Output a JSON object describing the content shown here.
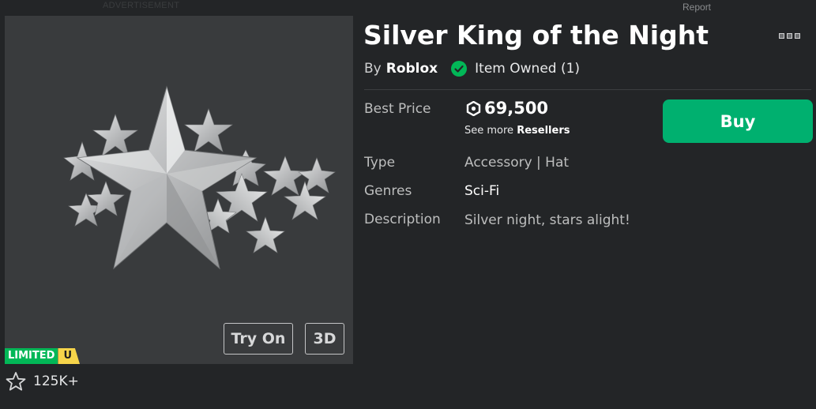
{
  "top_banner": {
    "advertisement_label": "ADVERTISEMENT",
    "report_label": "Report"
  },
  "thumbnail": {
    "try_on_label": "Try On",
    "view_3d_label": "3D",
    "limited_label": "LIMITED",
    "limited_u_label": "U",
    "favorite_count": "125K+"
  },
  "item": {
    "title": "Silver King of the Night",
    "by_label": "By",
    "creator": "Roblox",
    "owned_text": "Item Owned (1)"
  },
  "details": {
    "best_price_label": "Best Price",
    "price": "69,500",
    "see_more_prefix": "See more",
    "see_more_link": "Resellers",
    "buy_label": "Buy",
    "type_label": "Type",
    "type_value": "Accessory | Hat",
    "genres_label": "Genres",
    "genres_value": "Sci-Fi",
    "description_label": "Description",
    "description_value": "Silver night, stars alight!"
  },
  "colors": {
    "background": "#232527",
    "thumbnail_bg": "#393b3d",
    "buy_green": "#00b06f",
    "limited_green": "#02b757",
    "limited_yellow": "#f6d44a",
    "owned_check": "#02b757"
  },
  "icons": [
    "ellipsis-icon",
    "check-circle-icon",
    "robux-icon",
    "star-outline-icon",
    "star-crown-hat-image"
  ]
}
